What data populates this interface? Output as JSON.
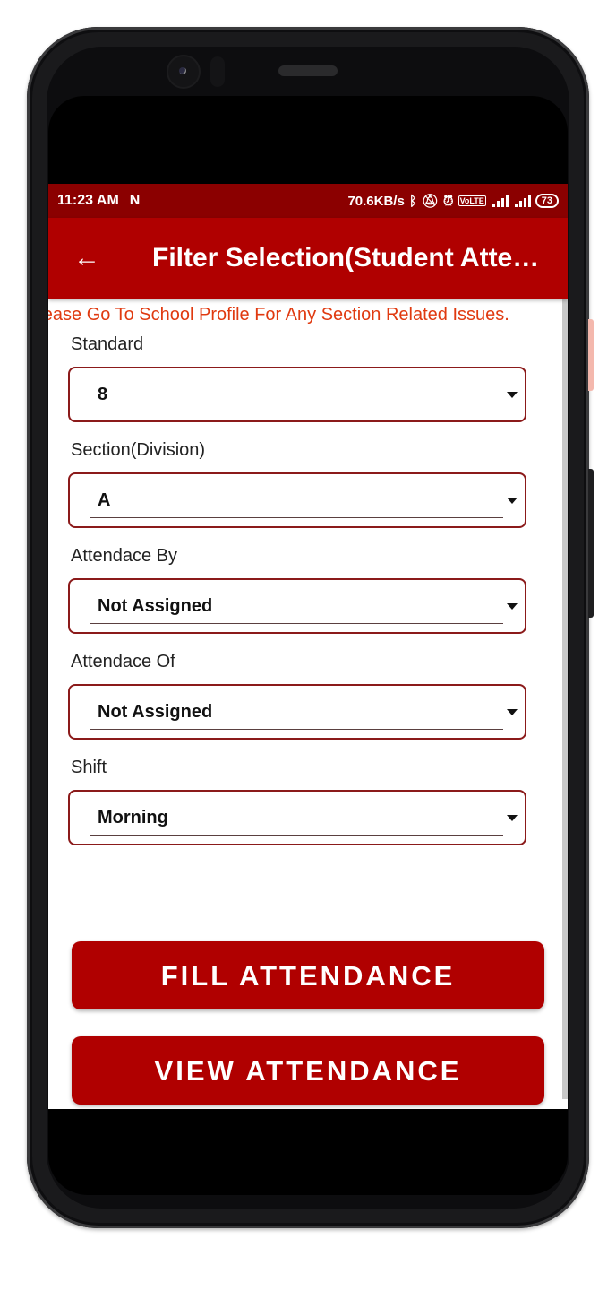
{
  "status_bar": {
    "time": "11:23 AM",
    "notification_icon": "n-icon",
    "network_speed": "70.6KB/s",
    "icons": [
      "bluetooth-icon",
      "mute-icon",
      "alarm-icon",
      "volte-icon",
      "signal-4g-icon",
      "signal-icon"
    ],
    "battery": "73"
  },
  "app_bar": {
    "back_icon": "←",
    "title": "Filter Selection(Student Attendance)"
  },
  "notice": "Please Go To School Profile For Any Section Related Issues.",
  "fields": [
    {
      "label": "Standard",
      "value": "8"
    },
    {
      "label": "Section(Division)",
      "value": "A"
    },
    {
      "label": "Attendace By",
      "value": "Not Assigned"
    },
    {
      "label": "Attendace Of",
      "value": "Not Assigned"
    },
    {
      "label": "Shift",
      "value": "Morning"
    }
  ],
  "buttons": {
    "fill": "FILL ATTENDANCE",
    "view": "VIEW ATTENDANCE"
  },
  "colors": {
    "status_bar": "#8b0000",
    "primary": "#b00000",
    "notice_text": "#e03a10",
    "dropdown_border": "#8b1a1a"
  }
}
